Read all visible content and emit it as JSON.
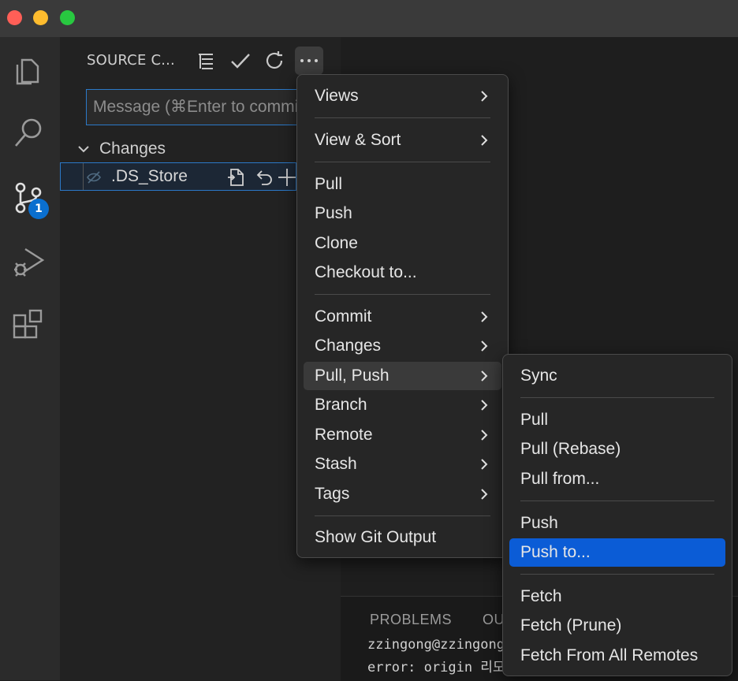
{
  "sidebar": {
    "title": "SOURCE C...",
    "message_placeholder": "Message (⌘Enter to commit)",
    "changes_header": "Changes",
    "badge_count": "1",
    "file": {
      "name": ".DS_Store"
    }
  },
  "menu": {
    "items": [
      "Views",
      "View & Sort",
      "Pull",
      "Push",
      "Clone",
      "Checkout to...",
      "Commit",
      "Changes",
      "Pull, Push",
      "Branch",
      "Remote",
      "Stash",
      "Tags",
      "Show Git Output"
    ],
    "highlighted": "Pull, Push"
  },
  "submenu": {
    "items": [
      "Sync",
      "Pull",
      "Pull (Rebase)",
      "Pull from...",
      "Push",
      "Push to...",
      "Fetch",
      "Fetch (Prune)",
      "Fetch From All Remotes"
    ],
    "highlighted": "Push to..."
  },
  "panel": {
    "tabs": [
      "PROBLEMS",
      "OU"
    ],
    "terminal_lines": [
      "zzingong@zzingong",
      "error: origin 리모"
    ]
  },
  "colors": {
    "accent": "#0b5cd6",
    "badge": "#0a6fcf",
    "focus_border": "#2b79c8"
  }
}
